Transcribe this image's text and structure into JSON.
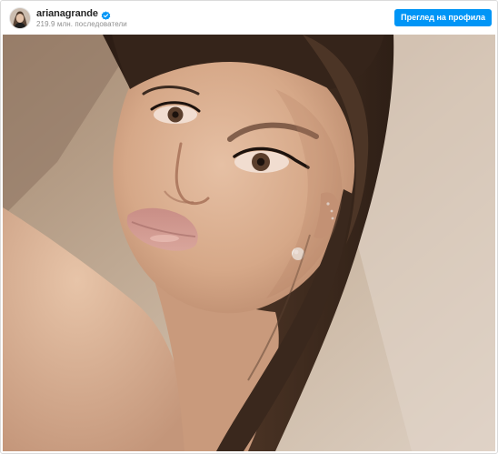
{
  "header": {
    "username": "arianagrande",
    "verified": true,
    "followers": "219.9 млн. последователи",
    "profile_button_label": "Преглед на профила"
  },
  "icons": {
    "verified": "verified-badge-icon",
    "avatar": "profile-avatar"
  },
  "colors": {
    "accent": "#0095f6",
    "text_primary": "#262626",
    "text_secondary": "#8e8e8e",
    "border": "#dbdbdb"
  }
}
